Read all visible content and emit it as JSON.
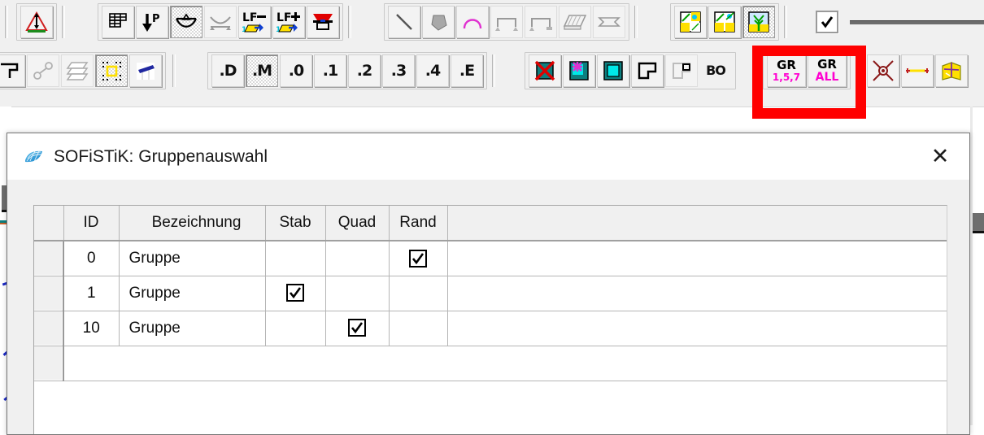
{
  "toolbars": {
    "row1": {
      "groups": [
        {
          "name": "support-group",
          "buttons": [
            {
              "icon": "support-triangle-icon",
              "label": ""
            }
          ]
        },
        {
          "name": "load-group",
          "buttons": [
            {
              "icon": "grid-mesh-icon",
              "label": ""
            },
            {
              "icon": "point-load-p-icon",
              "label": ""
            },
            {
              "icon": "beam-support-icon",
              "label": "",
              "pressed": true
            },
            {
              "icon": "beam-line-icon",
              "label": "",
              "disabled": true
            },
            {
              "icon": "loadcase-minus-icon",
              "label": "LF−"
            },
            {
              "icon": "loadcase-plus-icon",
              "label": "LF+"
            },
            {
              "icon": "section-red-icon",
              "label": ""
            }
          ]
        },
        {
          "name": "geometry-group",
          "buttons": [
            {
              "icon": "diagonal-line-icon",
              "label": ""
            },
            {
              "icon": "filled-polygon-icon",
              "label": ""
            },
            {
              "icon": "arc-magenta-icon",
              "label": ""
            },
            {
              "icon": "beam-bracket-icon",
              "label": "",
              "disabled": true
            },
            {
              "icon": "beam-bracket-2-icon",
              "label": "",
              "disabled": true
            },
            {
              "icon": "slab-icon",
              "label": "",
              "disabled": true
            },
            {
              "icon": "section-profile-icon",
              "label": "",
              "disabled": true
            }
          ]
        },
        {
          "name": "view-group",
          "buttons": [
            {
              "icon": "view-split-1-icon",
              "label": ""
            },
            {
              "icon": "view-split-2-icon",
              "label": ""
            },
            {
              "icon": "view-tree-icon",
              "label": "",
              "pressed": true
            }
          ]
        },
        {
          "name": "linestyle-group",
          "checkbox_checked": true,
          "line_preview": true
        }
      ]
    },
    "row2": {
      "groups": [
        {
          "name": "selection-group",
          "buttons": [
            {
              "icon": "corner-bracket-icon",
              "label": ""
            },
            {
              "icon": "node-link-icon",
              "label": "",
              "disabled": true
            },
            {
              "icon": "layers-icon",
              "label": "",
              "disabled": true
            },
            {
              "icon": "select-rect-icon",
              "label": "",
              "pressed": true
            },
            {
              "icon": "plane-blue-icon",
              "label": ""
            }
          ]
        },
        {
          "name": "decimals-group",
          "buttons": [
            {
              "icon": "text-icon",
              "label": ".D"
            },
            {
              "icon": "text-icon",
              "label": ".M",
              "pressed": true
            },
            {
              "icon": "text-icon",
              "label": ".0"
            },
            {
              "icon": "text-icon",
              "label": ".1"
            },
            {
              "icon": "text-icon",
              "label": ".2"
            },
            {
              "icon": "text-icon",
              "label": ".3"
            },
            {
              "icon": "text-icon",
              "label": ".4"
            },
            {
              "icon": "text-icon",
              "label": ".E"
            }
          ]
        },
        {
          "name": "display-group",
          "buttons": [
            {
              "icon": "no-fill-red-x-icon",
              "label": ""
            },
            {
              "icon": "fill-star-icon",
              "label": ""
            },
            {
              "icon": "fill-solid-icon",
              "label": ""
            },
            {
              "icon": "outline-corner-icon",
              "label": ""
            },
            {
              "icon": "outline-corner-light-icon",
              "label": "",
              "disabled": true
            },
            {
              "icon": "text-icon",
              "label": "BO"
            }
          ]
        },
        {
          "name": "group-filter-group",
          "buttons": [
            {
              "icon": "group-number-icon",
              "label": "GR",
              "sub_label": "1,5,7"
            },
            {
              "icon": "group-all-icon",
              "label": "GR",
              "sub_label": "ALL"
            }
          ]
        },
        {
          "name": "measure-group",
          "buttons": [
            {
              "icon": "crosshair-target-icon",
              "label": ""
            },
            {
              "icon": "dimension-line-icon",
              "label": ""
            },
            {
              "icon": "surface-mesh-yellow-icon",
              "label": ""
            }
          ]
        }
      ]
    }
  },
  "highlight": {
    "name": "red-annotation-rectangle",
    "color": "#ff0000",
    "target": "group-filter-group"
  },
  "dialog": {
    "icon": "sofistik-mesh-icon",
    "title": "SOFiSTiK: Gruppenauswahl",
    "close_label": "✕",
    "table": {
      "columns": [
        "ID",
        "Bezeichnung",
        "Stab",
        "Quad",
        "Rand"
      ],
      "rows": [
        {
          "id": "0",
          "bezeichnung": "Gruppe",
          "stab": false,
          "quad": false,
          "rand": true
        },
        {
          "id": "1",
          "bezeichnung": "Gruppe",
          "stab": true,
          "quad": false,
          "rand": false
        },
        {
          "id": "10",
          "bezeichnung": "Gruppe",
          "stab": false,
          "quad": true,
          "rand": false
        }
      ],
      "checkmark": "✔"
    }
  },
  "colors": {
    "accent_magenta": "#ff00d0",
    "highlight_red": "#ff0000",
    "dialog_title_bar": "#ffffff",
    "toolbar_bg": "#f0f0f0",
    "teal": "#0b7f7f",
    "blue": "#1b29c4"
  }
}
